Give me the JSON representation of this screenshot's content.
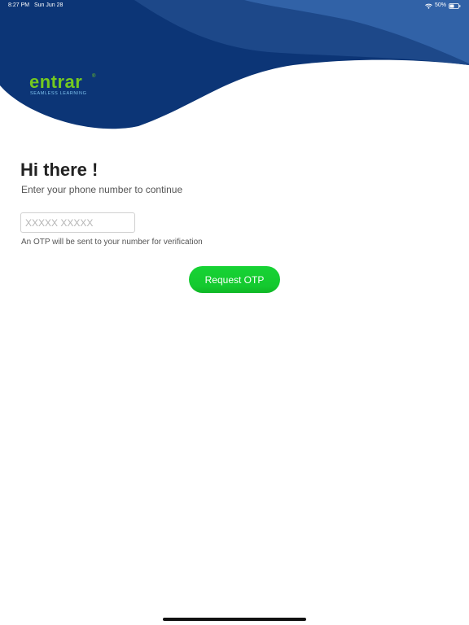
{
  "status_bar": {
    "time": "8:27 PM",
    "date": "Sun Jun 28",
    "battery_percent": "50%",
    "battery_level": 0.5,
    "icons": [
      "wifi-icon",
      "battery-icon"
    ]
  },
  "brand": {
    "name": "entrar",
    "trademark": "®",
    "tagline": "SEAMLESS LEARNING",
    "primary_color": "#74c91f",
    "tagline_color": "#7fc3ef"
  },
  "header": {
    "wave_colors": [
      "#0c3576",
      "#1d4889",
      "#3162a7"
    ]
  },
  "login": {
    "greeting": "Hi there !",
    "subtitle": "Enter your phone number to continue",
    "phone_field": {
      "value": "",
      "placeholder": "XXXXX XXXXX"
    },
    "otp_note": "An OTP will be sent to your number for verification",
    "request_button_label": "Request OTP",
    "button_color": "#17d335"
  }
}
